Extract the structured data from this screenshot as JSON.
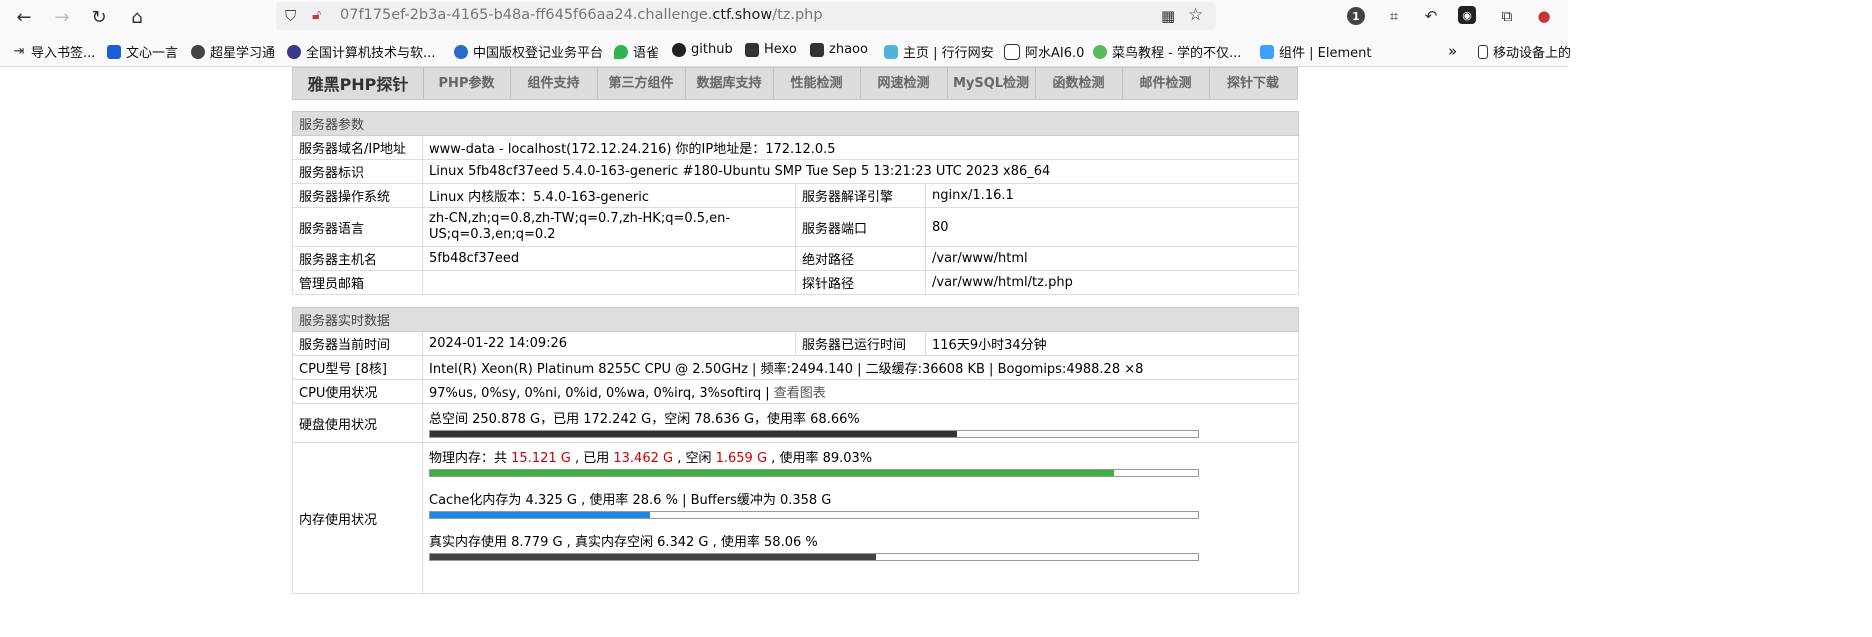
{
  "browser": {
    "url_host_prefix": "07f175ef-2b3a-4165-b48a-ff645f66aa24.challenge.",
    "url_host_main": "ctf.show",
    "url_path": "/tz.php",
    "ext_badge": "1"
  },
  "bookmarks": [
    {
      "label": "导入书签...",
      "icon_color": "#555"
    },
    {
      "label": "文心一言",
      "icon_color": "#1a5fd6"
    },
    {
      "label": "超星学习通",
      "icon_color": "#444"
    },
    {
      "label": "全国计算机技术与软...",
      "icon_color": "#3a3a8a"
    },
    {
      "label": "中国版权登记业务平台",
      "icon_color": "#2a6ac8"
    },
    {
      "label": "语雀",
      "icon_color": "#31b44b"
    },
    {
      "label": "github",
      "icon_color": "#222"
    },
    {
      "label": "Hexo",
      "icon_color": "#333"
    },
    {
      "label": "zhaoo",
      "icon_color": "#333"
    },
    {
      "label": "主页 | 行行网安",
      "icon_color": "#4fb3d9"
    },
    {
      "label": "阿水AI6.0",
      "icon_color": "#333"
    },
    {
      "label": "菜鸟教程 - 学的不仅...",
      "icon_color": "#5cb85c"
    },
    {
      "label": "组件 | Element",
      "icon_color": "#409eff"
    },
    {
      "label": "移动设备上的",
      "icon_color": "#333"
    }
  ],
  "nav": {
    "brand": "雅黑PHP探针",
    "items": [
      "PHP参数",
      "组件支持",
      "第三方组件",
      "数据库支持",
      "性能检测",
      "网速检测",
      "MySQL检测",
      "函数检测",
      "邮件检测",
      "探针下载"
    ]
  },
  "server_params": {
    "title": "服务器参数",
    "domain_label": "服务器域名/IP地址",
    "domain_value": "www-data - localhost(172.12.24.216)  你的IP地址是：172.12.0.5",
    "id_label": "服务器标识",
    "id_value": "Linux 5fb48cf37eed 5.4.0-163-generic #180-Ubuntu SMP Tue Sep 5 13:21:23 UTC 2023 x86_64",
    "os_label": "服务器操作系统",
    "os_value": "Linux  内核版本：5.4.0-163-generic",
    "engine_label": "服务器解译引擎",
    "engine_value": "nginx/1.16.1",
    "lang_label": "服务器语言",
    "lang_value": "zh-CN,zh;q=0.8,zh-TW;q=0.7,zh-HK;q=0.5,en-US;q=0.3,en;q=0.2",
    "port_label": "服务器端口",
    "port_value": "80",
    "host_label": "服务器主机名",
    "host_value": "5fb48cf37eed",
    "abs_label": "绝对路径",
    "abs_value": "/var/www/html",
    "admin_label": "管理员邮箱",
    "admin_value": "",
    "probe_label": "探针路径",
    "probe_value": "/var/www/html/tz.php"
  },
  "realtime": {
    "title": "服务器实时数据",
    "time_label": "服务器当前时间",
    "time_value": "2024-01-22 14:09:26",
    "uptime_label": "服务器已运行时间",
    "uptime_value": "116天9小时34分钟",
    "cpu_label": "CPU型号 [8核]",
    "cpu_value": "Intel(R) Xeon(R) Platinum 8255C CPU @ 2.50GHz | 频率:2494.140 | 二级缓存:36608 KB | Bogomips:4988.28 ×8",
    "cpu_usage_label": "CPU使用状况",
    "cpu_usage_value": "97%us, 0%sy, 0%ni, 0%id, 0%wa, 0%irq, 3%softirq | ",
    "cpu_chart_link": "查看图表",
    "disk_label": "硬盘使用状况",
    "disk_text": "总空间 250.878 G，已用 172.242 G，空闲 78.636 G，使用率 68.66%",
    "disk_used_fraction": 0.6866,
    "disk_bar_color": "#333333",
    "mem_label": "内存使用状况",
    "phys_prefix": "物理内存：共 ",
    "phys_total": "15.121 G",
    "phys_used_prefix": " , 已用 ",
    "phys_used": "13.462 G",
    "phys_free_prefix": " , 空闲 ",
    "phys_free": "1.659 G",
    "phys_rate": " , 使用率 89.03%",
    "phys_fraction": 0.8903,
    "phys_bar_color": "#3cb043",
    "cache_text": "Cache化内存为 4.325 G , 使用率 28.6 % | Buffers缓冲为 0.358 G",
    "cache_fraction": 0.286,
    "cache_bar_color": "#1e88e5",
    "real_text": "真实内存使用 8.779 G , 真实内存空闲 6.342 G , 使用率 58.06 %",
    "real_fraction": 0.5806,
    "real_bar_color": "#444444"
  }
}
